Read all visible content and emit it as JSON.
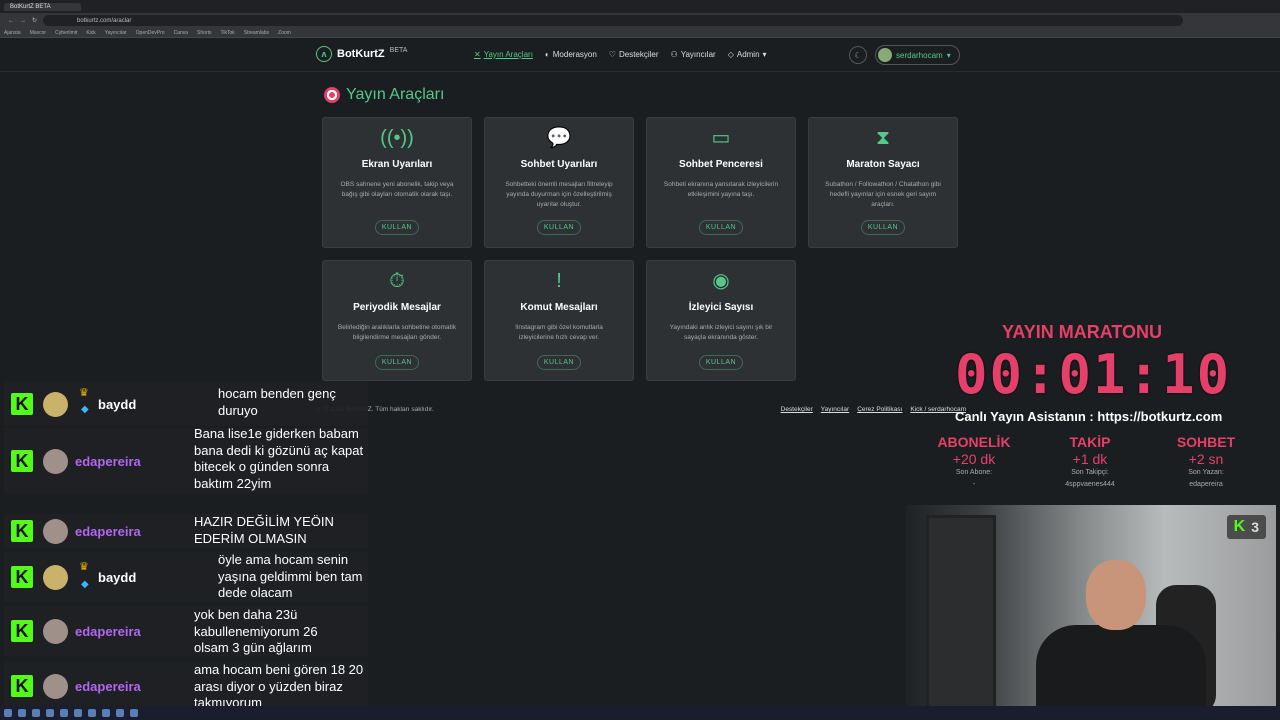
{
  "browser": {
    "tab_title": "BotKurtZ BETA",
    "url": "botkurtz.com/araclar",
    "bookmarks": [
      "Ajansta",
      "Maxcor",
      "Cyberlimit",
      "Kick",
      "Yayıncılar",
      "OpenDevPro",
      "Canva",
      "Shorts",
      "TikTok",
      "Streamlabs",
      "Zoom"
    ]
  },
  "nav": {
    "brand": "BotKurtZ",
    "beta": "BETA",
    "links": [
      {
        "label": "Yayın Araçları",
        "icon": "tools-icon",
        "active": true
      },
      {
        "label": "Moderasyon",
        "icon": "shield-icon"
      },
      {
        "label": "Destekçiler",
        "icon": "heart-icon"
      },
      {
        "label": "Yayıncılar",
        "icon": "users-icon"
      },
      {
        "label": "Admin",
        "icon": "shield-check-icon"
      }
    ],
    "user": "serdarhocam"
  },
  "page": {
    "title": "Yayın Araçları",
    "cards": [
      {
        "title": "Ekran Uyarıları",
        "desc": "OBS sahnene yeni abonelik, takip veya bağış gibi olayları otomatik olarak taşı.",
        "button": "KULLAN",
        "icon": "broadcast-icon"
      },
      {
        "title": "Sohbet Uyarıları",
        "desc": "Sohbetteki önemli mesajları filtreleyip yayında duyurman için özelleştirilmiş uyarılar oluştur.",
        "button": "KULLAN",
        "icon": "chat-dots-icon"
      },
      {
        "title": "Sohbet Penceresi",
        "desc": "Sohbeti ekranına yansıtarak izleyicilerin etkileşimini yayına taşı.",
        "button": "KULLAN",
        "icon": "chat-window-icon"
      },
      {
        "title": "Maraton Sayacı",
        "desc": "Subathon / Followathon / Chatathon gibi hedefli yayınlar için esnek geri sayım araçları.",
        "button": "KULLAN",
        "icon": "hourglass-icon"
      },
      {
        "title": "Periyodik Mesajlar",
        "desc": "Belirlediğin aralıklarla sohbetine otomatik bilgilendirme mesajları gönder.",
        "button": "KULLAN",
        "icon": "stopwatch-icon"
      },
      {
        "title": "Komut Mesajları",
        "desc": "!instagram gibi özel komutlarla izleyicilerine hızlı cevap ver.",
        "button": "KULLAN",
        "icon": "exclamation-icon"
      },
      {
        "title": "İzleyici Sayısı",
        "desc": "Yayındaki anlık izleyici sayını şık bir sayaçla ekranında göster.",
        "button": "KULLAN",
        "icon": "eye-icon"
      }
    ]
  },
  "footer": {
    "copyright": "© 2025 BotKurtZ. Tüm hakları saklıdır.",
    "links": [
      "Destekçiler",
      "Yayıncılar",
      "Çerez Politikası",
      "Kick / serdarhocam"
    ]
  },
  "chat": [
    {
      "user": "baydd",
      "text": "hocam benden genç duruyo"
    },
    {
      "user": "edapereira",
      "text": "Bana lise1e giderken babam bana dedi ki gözünü aç kapat bitecek o günden sonra baktım 22yim"
    },
    {
      "user": "edapereira",
      "text": "HAZIR DEĞİLİM YEÖIN EDERİM OLMASIN"
    },
    {
      "user": "baydd",
      "text": "öyle ama hocam senin yaşına geldimmi ben tam dede olacam"
    },
    {
      "user": "edapereira",
      "text": "yok ben daha 23ü kabullenemiyorum 26 olsam 3 gün ağlarım"
    },
    {
      "user": "edapereira",
      "text": "ama hocam beni gören 18 20 arası diyor o yüzden biraz takmıyorum"
    }
  ],
  "marathon": {
    "title": "YAYIN MARATONU",
    "timer": "00:01:10",
    "assistant": "Canlı Yayın Asistanın : https://botkurtz.com",
    "stats": [
      {
        "label": "ABONELİK",
        "value": "+20 dk",
        "sub": "Son Abone:",
        "name": "-"
      },
      {
        "label": "TAKİP",
        "value": "+1 dk",
        "sub": "Son Takipçi:",
        "name": "4sppvaenes444"
      },
      {
        "label": "SOHBET",
        "value": "+2 sn",
        "sub": "Son Yazan:",
        "name": "edapereira"
      }
    ]
  },
  "webcam": {
    "viewer_count": "3"
  },
  "colors": {
    "accent": "#55c88a",
    "marathon": "#e4406a",
    "kick": "#53fc18",
    "eda": "#b167f0"
  }
}
